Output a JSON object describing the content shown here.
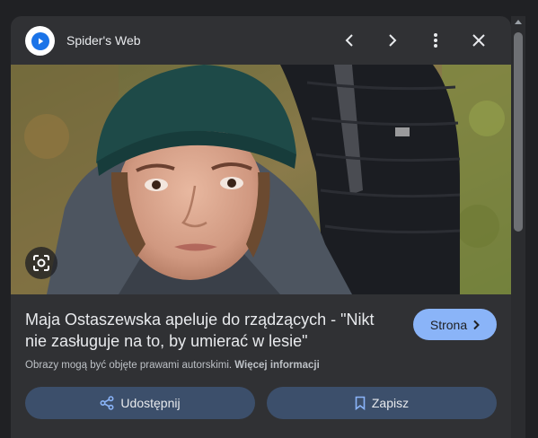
{
  "header": {
    "source_name": "Spider's Web",
    "logo_icon": "spiders-web-logo-icon",
    "prev_icon": "chevron-left-icon",
    "next_icon": "chevron-right-icon",
    "more_icon": "more-vert-icon",
    "close_icon": "close-icon"
  },
  "image": {
    "lens_icon": "google-lens-icon"
  },
  "result": {
    "title": "Maja Ostaszewska apeluje do rządzących - \"Nikt nie zasługuje na to, by umierać w lesie\"",
    "visit_label": "Strona",
    "notice_text": "Obrazy mogą być objęte prawami autorskimi.",
    "notice_link": "Więcej informacji"
  },
  "actions": {
    "share_label": "Udostępnij",
    "save_label": "Zapisz"
  },
  "colors": {
    "accent": "#8ab4f8",
    "panel_bg": "#303134",
    "button_bg": "#3c4f6b"
  }
}
